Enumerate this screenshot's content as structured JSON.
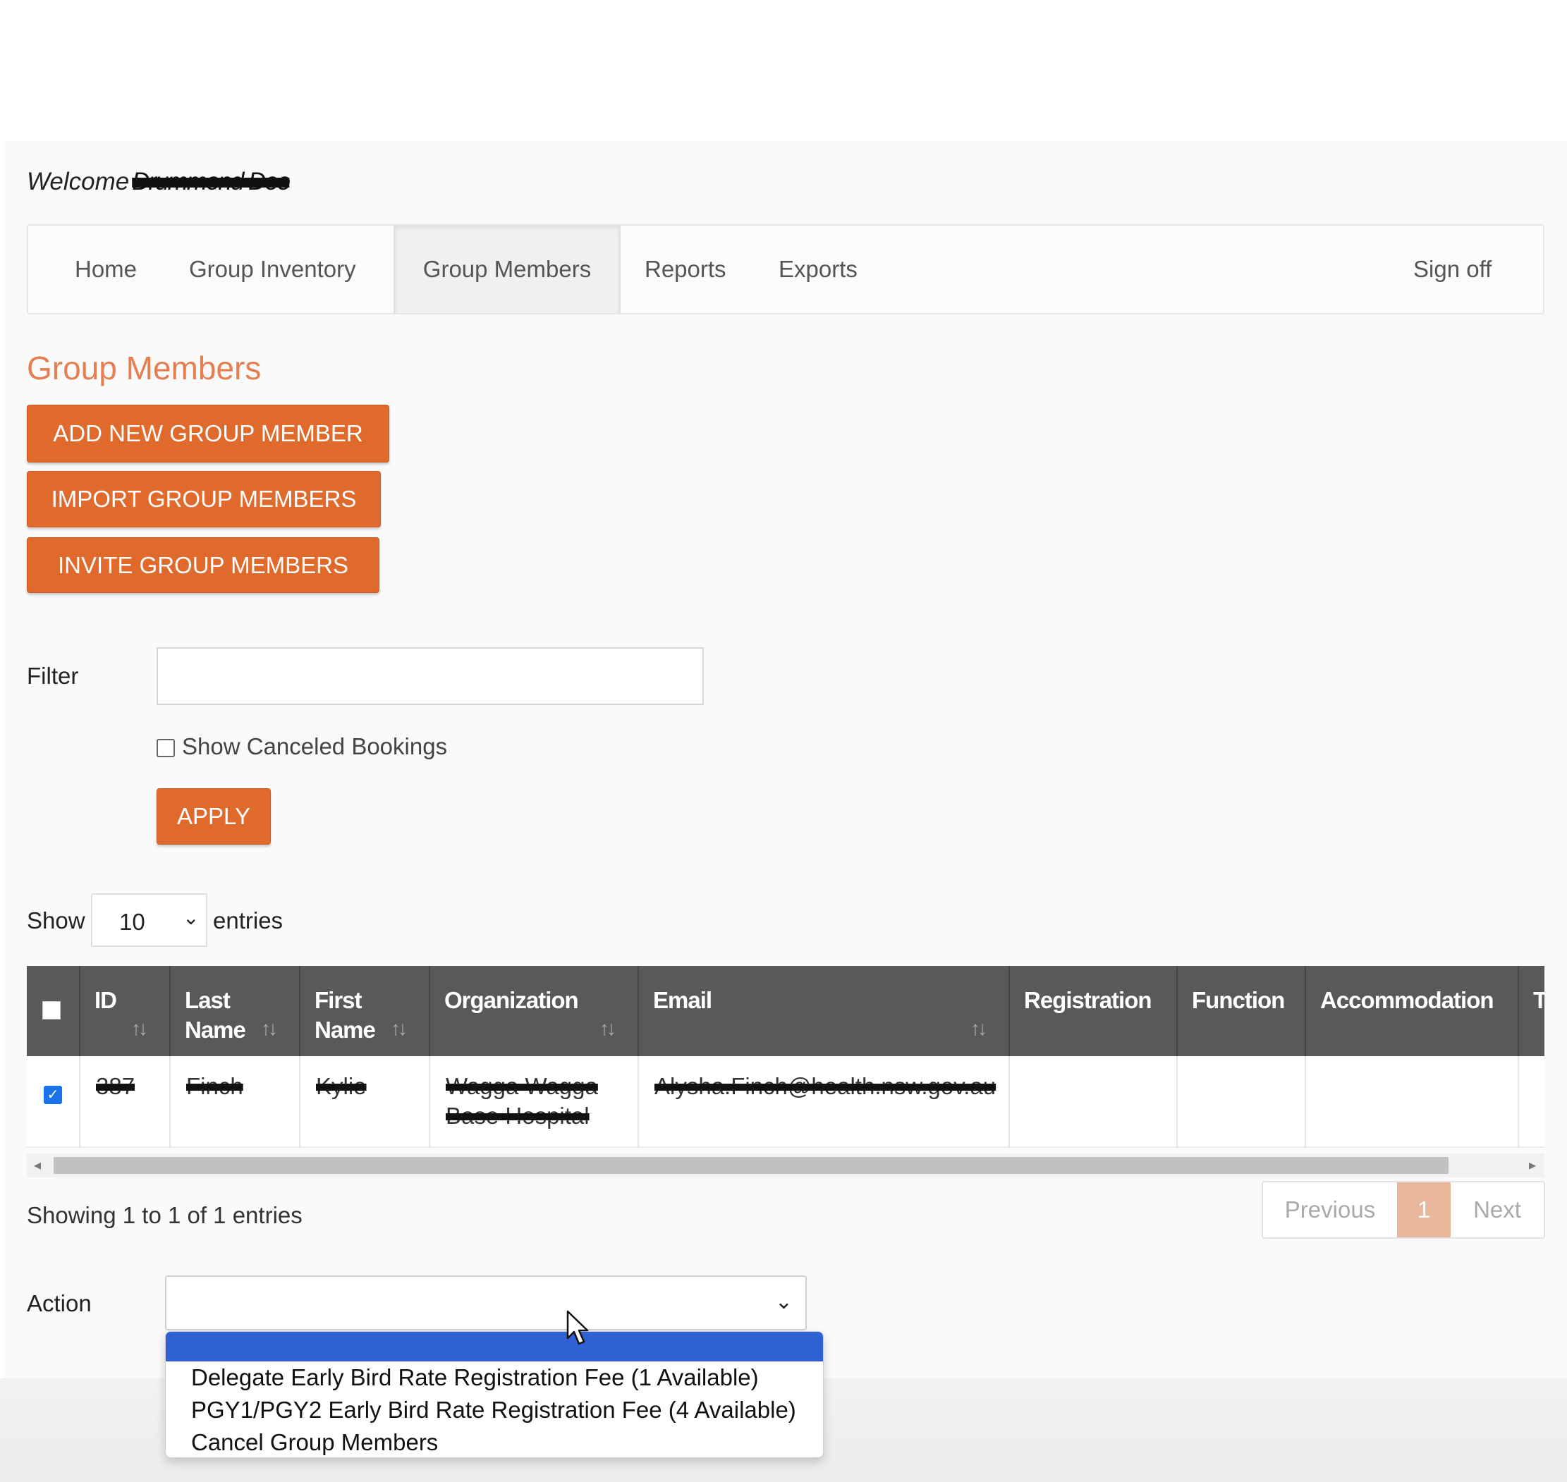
{
  "header": {
    "welcome_label": "Welcome",
    "user_name": "Drummond Dee"
  },
  "nav": {
    "items": [
      {
        "label": "Home"
      },
      {
        "label": "Group Inventory"
      },
      {
        "label": "Group Members",
        "active": true
      },
      {
        "label": "Reports"
      },
      {
        "label": "Exports"
      }
    ],
    "sign_off": "Sign off"
  },
  "page": {
    "title": "Group Members",
    "buttons": {
      "add": "ADD NEW GROUP MEMBER",
      "import": "IMPORT GROUP MEMBERS",
      "invite": "INVITE GROUP MEMBERS"
    }
  },
  "filter": {
    "label": "Filter",
    "value": "",
    "show_canceled_label": "Show Canceled Bookings",
    "show_canceled_checked": false,
    "apply": "APPLY"
  },
  "entries": {
    "show_label": "Show",
    "selected": "10",
    "entries_label": "entries"
  },
  "table": {
    "columns": [
      {
        "l1": "ID",
        "l2": ""
      },
      {
        "l1": "Last",
        "l2": "Name"
      },
      {
        "l1": "First",
        "l2": "Name"
      },
      {
        "l1": "Organization",
        "l2": ""
      },
      {
        "l1": "Email",
        "l2": ""
      },
      {
        "l1": "Registration",
        "l2": ""
      },
      {
        "l1": "Function",
        "l2": ""
      },
      {
        "l1": "Accommodation",
        "l2": ""
      },
      {
        "l1": "T",
        "l2": ""
      }
    ],
    "rows": [
      {
        "checked": true,
        "id": "387",
        "last_name": "Finch",
        "first_name": "Kylie",
        "organization_l1": "Wagga Wagga",
        "organization_l2": "Base Hospital",
        "email": "Alysha.Finch@health.nsw.gov.au",
        "registration": "",
        "function": "",
        "accommodation": ""
      }
    ]
  },
  "footer": {
    "info": "Showing 1 to 1 of 1 entries",
    "pagination": {
      "previous": "Previous",
      "current": "1",
      "next": "Next"
    }
  },
  "action": {
    "label": "Action",
    "selected": "",
    "options": [
      "",
      "Delegate Early Bird Rate Registration Fee (1 Available)",
      "PGY1/PGY2 Early Bird Rate Registration Fee (4 Available)",
      "Cancel Group Members"
    ]
  },
  "colors": {
    "accent": "#e0692c",
    "title": "#e57f51",
    "table_header": "#595959",
    "dropdown_highlight": "#2f61d5"
  }
}
